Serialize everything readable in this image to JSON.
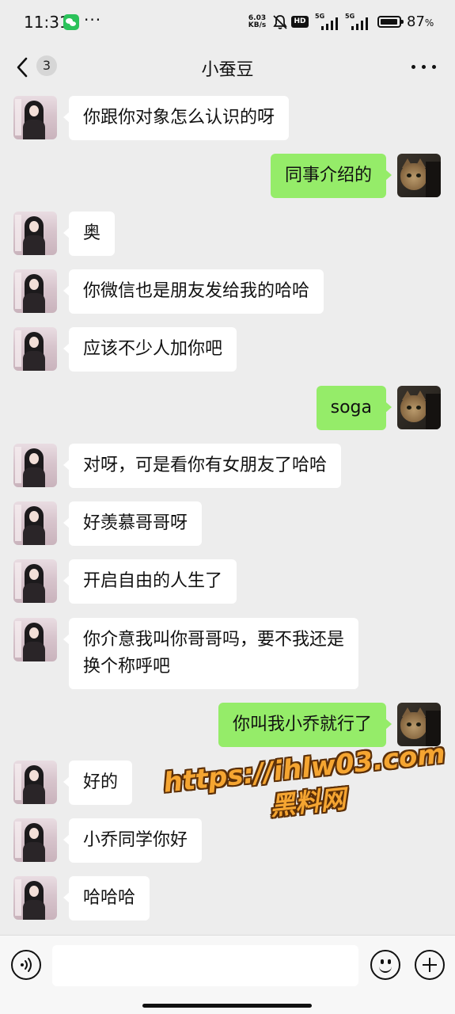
{
  "status_bar": {
    "time": "11:31",
    "more_dots": "···",
    "net_speed_value": "6.03",
    "net_speed_unit": "KB/s",
    "hd_label": "HD",
    "signal_1_label": "5G",
    "signal_2_label": "5G",
    "battery_level": "87",
    "battery_unit": "%",
    "icons": [
      "wechat-icon",
      "mute-icon",
      "hd-icon",
      "signal-icon",
      "battery-icon"
    ]
  },
  "header": {
    "back_icon": "chevron-left-icon",
    "unread_count": "3",
    "title": "小蚕豆",
    "more_icon": "ellipsis-icon"
  },
  "messages": [
    {
      "side": "in",
      "text": "你跟你对象怎么认识的呀"
    },
    {
      "side": "out",
      "text": "同事介绍的"
    },
    {
      "side": "in",
      "text": "奥"
    },
    {
      "side": "in",
      "text": "你微信也是朋友发给我的哈哈"
    },
    {
      "side": "in",
      "text": "应该不少人加你吧"
    },
    {
      "side": "out",
      "text": "soga"
    },
    {
      "side": "in",
      "text": "对呀，可是看你有女朋友了哈哈"
    },
    {
      "side": "in",
      "text": "好羡慕哥哥呀"
    },
    {
      "side": "in",
      "text": "开启自由的人生了"
    },
    {
      "side": "in",
      "text": "你介意我叫你哥哥吗，要不我还是\n换个称呼吧"
    },
    {
      "side": "out",
      "text": "你叫我小乔就行了"
    },
    {
      "side": "in",
      "text": "好的"
    },
    {
      "side": "in",
      "text": "小乔同学你好"
    },
    {
      "side": "in",
      "text": "哈哈哈"
    }
  ],
  "watermark": {
    "url": "https://ihlw03.com",
    "site": "黑料网"
  },
  "input_bar": {
    "voice_icon": "voice-icon",
    "input_value": "",
    "emoji_icon": "emoji-icon",
    "plus_icon": "plus-icon"
  },
  "colors": {
    "background": "#ededed",
    "incoming_bubble": "#ffffff",
    "outgoing_bubble": "#95ec69",
    "watermark_fill": "#f5a531"
  }
}
